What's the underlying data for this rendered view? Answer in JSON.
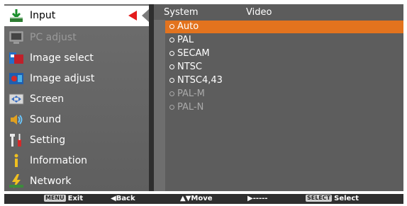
{
  "menu": {
    "items": [
      {
        "label": "Input",
        "icon": "input-icon",
        "state": "selected"
      },
      {
        "label": "PC adjust",
        "icon": "pc-adjust-icon",
        "state": "disabled"
      },
      {
        "label": "Image select",
        "icon": "image-select-icon",
        "state": "normal"
      },
      {
        "label": "Image adjust",
        "icon": "image-adjust-icon",
        "state": "normal"
      },
      {
        "label": "Screen",
        "icon": "screen-icon",
        "state": "normal"
      },
      {
        "label": "Sound",
        "icon": "sound-icon",
        "state": "normal"
      },
      {
        "label": "Setting",
        "icon": "setting-icon",
        "state": "normal"
      },
      {
        "label": "Information",
        "icon": "information-icon",
        "state": "normal"
      },
      {
        "label": "Network",
        "icon": "network-icon",
        "state": "normal"
      }
    ]
  },
  "content": {
    "header_left": "System",
    "header_right": "Video",
    "options": [
      {
        "label": "Auto",
        "state": "selected"
      },
      {
        "label": "PAL",
        "state": "normal"
      },
      {
        "label": "SECAM",
        "state": "normal"
      },
      {
        "label": "NTSC",
        "state": "normal"
      },
      {
        "label": "NTSC4,43",
        "state": "normal"
      },
      {
        "label": "PAL-M",
        "state": "disabled"
      },
      {
        "label": "PAL-N",
        "state": "disabled"
      }
    ]
  },
  "footer": {
    "exit_key": "MENU",
    "exit_label": "Exit",
    "back_label": "◀Back",
    "move_label": "▲▼Move",
    "next_label": "▶-----",
    "select_key": "SELECT",
    "select_label": "Select"
  },
  "colors": {
    "highlight": "#e3731e",
    "marker": "#e41b1b"
  }
}
